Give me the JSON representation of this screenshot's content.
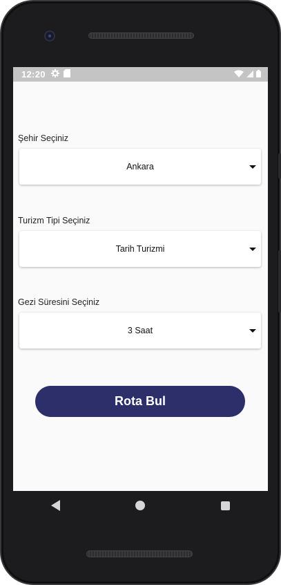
{
  "statusbar": {
    "time": "12:20",
    "icons": [
      "settings-icon",
      "sd-card-icon",
      "wifi-icon",
      "signal-icon",
      "battery-icon"
    ]
  },
  "form": {
    "city": {
      "label": "Şehir Seçiniz",
      "value": "Ankara"
    },
    "tourism_type": {
      "label": "Turizm Tipi Seçiniz",
      "value": "Tarih Turizmi"
    },
    "duration": {
      "label": "Gezi Süresini Seçiniz",
      "value": "3 Saat"
    }
  },
  "actions": {
    "find_route_label": "Rota Bul"
  },
  "colors": {
    "primary": "#2d2f6a",
    "background": "#fafafa",
    "statusbar": "#c4c4c4",
    "device": "#1c1c1e"
  },
  "navbar": {
    "icons": [
      "back-icon",
      "home-icon",
      "recents-icon"
    ]
  }
}
